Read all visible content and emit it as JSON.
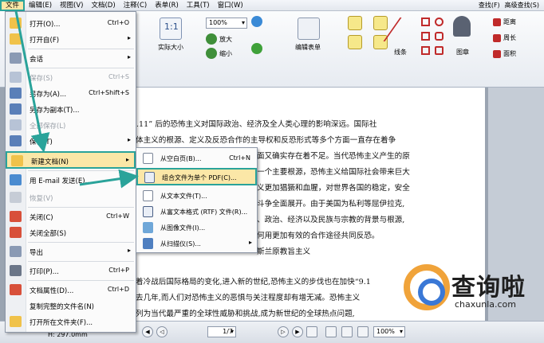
{
  "menubar": {
    "items": [
      "文件",
      "编辑(E)",
      "视图(V)",
      "文档(D)",
      "注释(C)",
      "表单(R)",
      "工具(T)",
      "窗口(W)"
    ],
    "find": "查找(F)",
    "advanced_find": "高级查找(S)"
  },
  "ribbon": {
    "actual_size": "实际大小",
    "zoom_value": "100%",
    "zoom_in": "放大",
    "zoom_out": "缩小",
    "edit_form": "编辑表单",
    "lines": "线条",
    "stamp": "图章",
    "distance": "距离",
    "perimeter": "周长",
    "area": "面积"
  },
  "document": {
    "lines": [
      "“9.11” 后的恐怖主义对国际政治、经济及全人类心理的影响深远。国际社",
      "体主义的根源、定义及反恐合作的主导权和反恐形式等多个方面一直存在着争",
      "面又确实存在着不足。当代恐怖主义产生的原",
      "一个主要根源，恐怖主义给国际社会带来巨大",
      "义更加猖獗和血腥，对世界各国的稳定，安全",
      "斗争全面展开。由于美国为私利等屈伊拉克,",
      "、政治、经济以及民族与宗教的背景与根源,",
      "何用更加有效的合作途径共同反恐。",
      "斯兰原教旨主义",
      "着冷战后国际格局的变化,进入新的世纪,恐怖主义的步伐也在加快“9.1",
      "去几年,而人们对恐怖主义的恶惧与关注程度却有增无减。恐怖主义",
      "列为当代最严重的全球性威胁和挑战,成为新世纪的全球热点问题,",
      "体恐怖主义对"
    ]
  },
  "statusbar": {
    "size": "H: 297.0mm",
    "page": "1/7",
    "zoom": "100%"
  },
  "file_menu": {
    "items": [
      {
        "label": "打开(O)...",
        "shortcut": "Ctrl+O"
      },
      {
        "label": "打开自(F)",
        "shortcut": ""
      },
      {
        "label": "会话",
        "shortcut": ""
      },
      {
        "label": "保存(S)",
        "shortcut": "Ctrl+S"
      },
      {
        "label": "另存为(A)...",
        "shortcut": "Ctrl+Shift+S"
      },
      {
        "label": "另存为副本(T)...",
        "shortcut": ""
      },
      {
        "label": "全部保存(L)",
        "shortcut": ""
      },
      {
        "label": "保存(T)",
        "shortcut": ""
      },
      {
        "label": "新建文档(N)",
        "shortcut": ""
      },
      {
        "label": "用 E-mail 发送(E)...",
        "shortcut": ""
      },
      {
        "label": "恢复(V)",
        "shortcut": ""
      },
      {
        "label": "关闭(C)",
        "shortcut": "Ctrl+W"
      },
      {
        "label": "关闭全部(S)",
        "shortcut": ""
      },
      {
        "label": "导出",
        "shortcut": ""
      },
      {
        "label": "打印(P)...",
        "shortcut": "Ctrl+P"
      },
      {
        "label": "文档属性(D)...",
        "shortcut": "Ctrl+D"
      },
      {
        "label": "复制完整的文件名(N)",
        "shortcut": ""
      },
      {
        "label": "打开所在文件夹(F)...",
        "shortcut": ""
      }
    ]
  },
  "submenu": {
    "items": [
      {
        "label": "从空白页(B)...",
        "shortcut": "Ctrl+N"
      },
      {
        "label": "组合文件为单个 PDF(C)...",
        "shortcut": ""
      },
      {
        "label": "从文本文件(T)...",
        "shortcut": ""
      },
      {
        "label": "从富文本格式 (RTF) 文件(R)...",
        "shortcut": ""
      },
      {
        "label": "从图像文件(I)...",
        "shortcut": ""
      },
      {
        "label": "从扫描仪(S)...",
        "shortcut": ""
      }
    ]
  },
  "watermark": {
    "title": "查询啦",
    "url": "chaxunla.com"
  },
  "colors": {
    "highlight_border": "#2aa39a",
    "highlight_fill": "#fbe7a7",
    "watermark_orange": "#f0a33a",
    "watermark_blue": "#3a78d6"
  }
}
